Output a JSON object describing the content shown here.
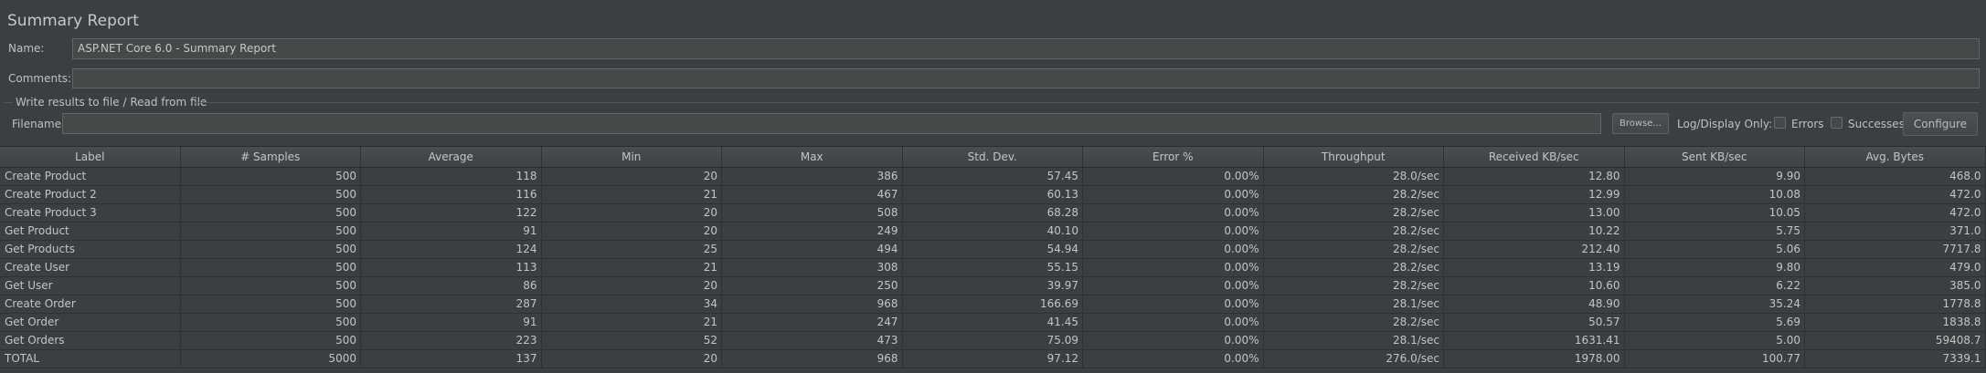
{
  "panel": {
    "title": "Summary Report"
  },
  "form": {
    "name_label": "Name:",
    "name_value": "ASP.NET Core 6.0 - Summary Report",
    "comments_label": "Comments:",
    "comments_value": "",
    "file_section_label": "Write results to file / Read from file",
    "filename_label": "Filename",
    "filename_value": "",
    "browse_label": "Browse...",
    "log_display_label": "Log/Display Only:",
    "errors_label": "Errors",
    "errors_checked": false,
    "successes_label": "Successes",
    "successes_checked": false,
    "configure_label": "Configure"
  },
  "table": {
    "columns": [
      "Label",
      "# Samples",
      "Average",
      "Min",
      "Max",
      "Std. Dev.",
      "Error %",
      "Throughput",
      "Received KB/sec",
      "Sent KB/sec",
      "Avg. Bytes"
    ],
    "rows": [
      [
        "Create Product",
        "500",
        "118",
        "20",
        "386",
        "57.45",
        "0.00%",
        "28.0/sec",
        "12.80",
        "9.90",
        "468.0"
      ],
      [
        "Create Product 2",
        "500",
        "116",
        "21",
        "467",
        "60.13",
        "0.00%",
        "28.2/sec",
        "12.99",
        "10.08",
        "472.0"
      ],
      [
        "Create Product 3",
        "500",
        "122",
        "20",
        "508",
        "68.28",
        "0.00%",
        "28.2/sec",
        "13.00",
        "10.05",
        "472.0"
      ],
      [
        "Get Product",
        "500",
        "91",
        "20",
        "249",
        "40.10",
        "0.00%",
        "28.2/sec",
        "10.22",
        "5.75",
        "371.0"
      ],
      [
        "Get Products",
        "500",
        "124",
        "25",
        "494",
        "54.94",
        "0.00%",
        "28.2/sec",
        "212.40",
        "5.06",
        "7717.8"
      ],
      [
        "Create User",
        "500",
        "113",
        "21",
        "308",
        "55.15",
        "0.00%",
        "28.2/sec",
        "13.19",
        "9.80",
        "479.0"
      ],
      [
        "Get User",
        "500",
        "86",
        "20",
        "250",
        "39.97",
        "0.00%",
        "28.2/sec",
        "10.60",
        "6.22",
        "385.0"
      ],
      [
        "Create Order",
        "500",
        "287",
        "34",
        "968",
        "166.69",
        "0.00%",
        "28.1/sec",
        "48.90",
        "35.24",
        "1778.8"
      ],
      [
        "Get Order",
        "500",
        "91",
        "21",
        "247",
        "41.45",
        "0.00%",
        "28.2/sec",
        "50.57",
        "5.69",
        "1838.8"
      ],
      [
        "Get Orders",
        "500",
        "223",
        "52",
        "473",
        "75.09",
        "0.00%",
        "28.1/sec",
        "1631.41",
        "5.00",
        "59408.7"
      ],
      [
        "TOTAL",
        "5000",
        "137",
        "20",
        "968",
        "97.12",
        "0.00%",
        "276.0/sec",
        "1978.00",
        "100.77",
        "7339.1"
      ]
    ]
  }
}
